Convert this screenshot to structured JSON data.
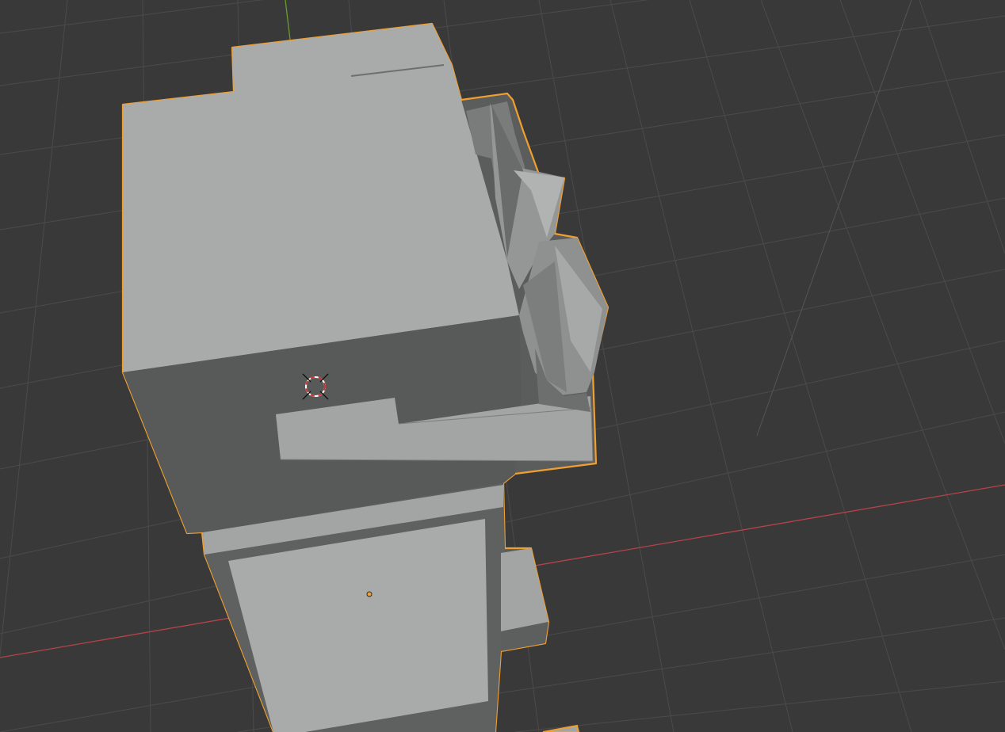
{
  "app": {
    "editor": "3D Viewport",
    "view": "perspective"
  },
  "scene": {
    "selected_object": {
      "outline_color": "#f0a030",
      "surface_color": "#a9abab",
      "shadow_color": "#575858"
    },
    "background_color": "#393939",
    "grid_color": "#4a4a4a",
    "x_axis_color": "#b5434a",
    "y_axis_color": "#6a9a2a"
  },
  "icons": {
    "cursor": "3d-cursor-icon",
    "origin": "object-origin-icon"
  }
}
